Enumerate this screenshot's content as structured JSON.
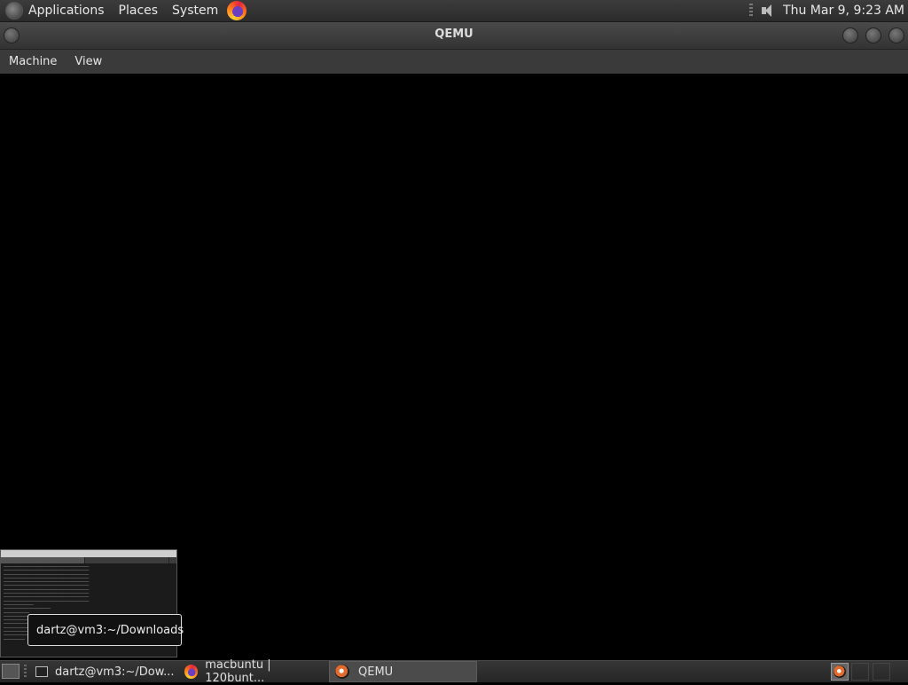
{
  "top_panel": {
    "menus": [
      "Applications",
      "Places",
      "System"
    ],
    "clock": "Thu Mar  9,  9:23 AM"
  },
  "qemu_window": {
    "title": "QEMU",
    "menu": [
      "Machine",
      "View"
    ]
  },
  "tooltip": {
    "text": "dartz@vm3:~/Downloads"
  },
  "taskbar": {
    "tasks": [
      {
        "label": "dartz@vm3:~/Dow...",
        "icon": "terminal-icon",
        "active": false
      },
      {
        "label": "macbuntu | 120bunt...",
        "icon": "firefox-icon",
        "active": false
      },
      {
        "label": "QEMU",
        "icon": "qemu-icon",
        "active": true
      }
    ]
  },
  "colors": {
    "panel_bg": "#2f2f2f",
    "screen_bg": "#000000"
  }
}
